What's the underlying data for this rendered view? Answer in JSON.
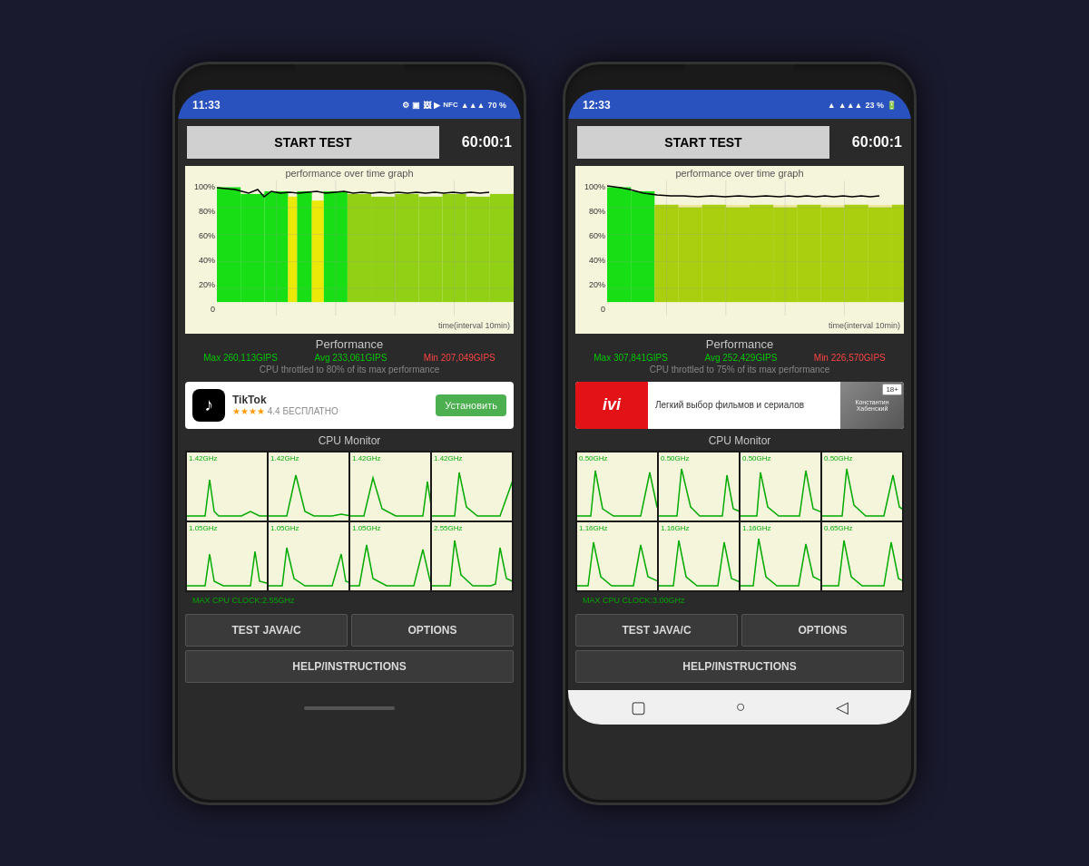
{
  "phone1": {
    "statusBar": {
      "time": "11:33",
      "batteryPercent": "70 %",
      "icons": "⚙ ▣ 🖼 ▶ NFC ▲ ▲ ▲"
    },
    "topBar": {
      "startTestLabel": "START TEST",
      "timer": "60:00:1"
    },
    "graph": {
      "title": "performance over time graph",
      "xLabel": "time(interval 10min)",
      "yLabels": [
        "100%",
        "80%",
        "60%",
        "40%",
        "20%",
        "0"
      ]
    },
    "performance": {
      "title": "Performance",
      "max": "Max 260,113GIPS",
      "avg": "Avg 233,061GIPS",
      "min": "Min 207,049GIPS",
      "throttle": "CPU throttled to 80% of its max performance"
    },
    "ad": {
      "type": "tiktok",
      "icon": "♪",
      "title": "TikTok",
      "rating": "4.4",
      "free": "БЕСПЛАТНО",
      "installLabel": "Установить"
    },
    "cpu": {
      "title": "CPU Monitor",
      "row1": [
        "1.42GHz",
        "1.42GHz",
        "1.42GHz",
        "1.42GHz"
      ],
      "row2": [
        "1.05GHz",
        "1.05GHz",
        "1.05GHz",
        "2.55GHz"
      ],
      "maxLabel": "MAX CPU CLOCK:2.55GHz"
    },
    "buttons": {
      "testJava": "TEST JAVA/C",
      "options": "OPTIONS",
      "help": "HELP/INSTRUCTIONS"
    }
  },
  "phone2": {
    "statusBar": {
      "time": "12:33",
      "batteryPercent": "23 %",
      "icons": "▲ ▲ ▲"
    },
    "topBar": {
      "startTestLabel": "START TEST",
      "timer": "60:00:1"
    },
    "graph": {
      "title": "performance over time graph",
      "xLabel": "time(interval 10min)",
      "yLabels": [
        "100%",
        "80%",
        "60%",
        "40%",
        "20%",
        "0"
      ]
    },
    "performance": {
      "title": "Performance",
      "max": "Max 307,841GIPS",
      "avg": "Avg 252,429GIPS",
      "min": "Min 226,570GIPS",
      "throttle": "CPU throttled to 75% of its max performance"
    },
    "ad": {
      "type": "ivi",
      "iviText": "Легкий выбор фильмов и сериалов",
      "iviName": "Константин Хабенский",
      "ivi18plus": "18+"
    },
    "cpu": {
      "title": "CPU Monitor",
      "row1": [
        "0.50GHz",
        "0.50GHz",
        "0.50GHz",
        "0.50GHz"
      ],
      "row2": [
        "1.16GHz",
        "1.16GHz",
        "1.16GHz",
        "0.65GHz"
      ],
      "maxLabel": "MAX CPU CLOCK:3.00GHz"
    },
    "buttons": {
      "testJava": "TEST JAVA/C",
      "options": "OPTIONS",
      "help": "HELP/INSTRUCTIONS"
    },
    "navBar": {
      "square": "▢",
      "circle": "○",
      "back": "◁"
    }
  }
}
